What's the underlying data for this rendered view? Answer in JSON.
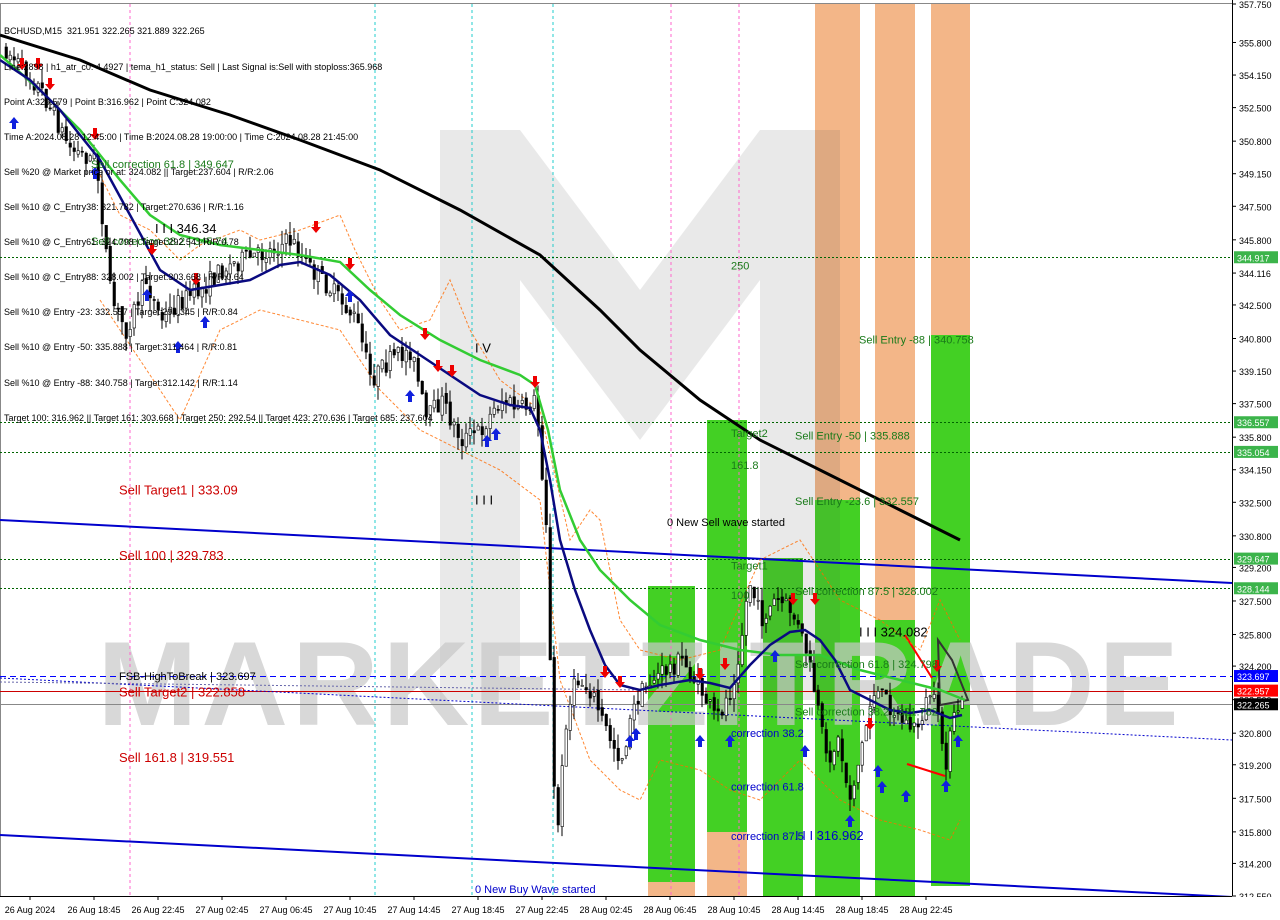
{
  "header": {
    "symbol": "BCHUSD,M15",
    "ohlc": "321.951 322.265 321.889 322.265"
  },
  "info_lines": [
    "Line:2898 | h1_atr_c0: 4.4927 | tema_h1_status: Sell | Last Signal is:Sell with stoploss:365.968",
    "Point A:329.579 | Point B:316.962 | Point C:324.082",
    "Time A:2024.08.28 12:45:00 | Time B:2024.08.28 19:00:00 | Time C:2024.08.28 21:45:00",
    "Sell %20 @ Market price or at: 324.082 || Target:237.604 | R/R:2.06",
    "Sell %10 @ C_Entry38: 321.782 | Target:270.636 | R/R:1.16",
    "Sell %10 @ C_Entry61: 324.798 | Target:292.54 | R/R:0.78",
    "Sell %10 @ C_Entry88: 328.002 | Target:303.668 | R/R:0.64",
    "Sell %10 @ Entry -23: 332.557 | Target:294.345 | R/R:0.84",
    "Sell %10 @ Entry -50: 335.888 | Target:311.464 | R/R:0.81",
    "Sell %10 @ Entry -88: 340.758 | Target:312.142 | R/R:1.14",
    "Target 100: 316.962 || Target 161: 303.668 | Target 250: 292.54 || Target 423: 270.636 | Target 685: 237.604"
  ],
  "watermark": "MARKETZITRADE",
  "colors": {
    "green_zone": "#33cc11",
    "orange_zone": "#f0a266",
    "ema_green": "#33cc33",
    "ema_navy": "#0a0a80",
    "ma_black": "#000000",
    "channel_blue": "#0000cc",
    "level_green": "#006400",
    "level_red": "#cc0000",
    "level_blue": "#0000ff"
  },
  "chart_data": {
    "type": "candlestick",
    "ylim": [
      312.55,
      357.75
    ],
    "y_ticks": [
      "357.750",
      "355.800",
      "354.150",
      "352.500",
      "350.800",
      "349.150",
      "347.500",
      "345.800",
      "344.116",
      "342.500",
      "340.800",
      "339.150",
      "337.500",
      "335.800",
      "334.150",
      "332.500",
      "330.800",
      "329.200",
      "327.500",
      "325.800",
      "324.200",
      "322.500",
      "320.800",
      "319.200",
      "317.500",
      "315.800",
      "314.200",
      "312.550"
    ],
    "x_ticks": [
      "26 Aug 2024",
      "26 Aug 18:45",
      "26 Aug 22:45",
      "27 Aug 02:45",
      "27 Aug 06:45",
      "27 Aug 10:45",
      "27 Aug 14:45",
      "27 Aug 18:45",
      "27 Aug 22:45",
      "28 Aug 02:45",
      "28 Aug 06:45",
      "28 Aug 10:45",
      "28 Aug 14:45",
      "28 Aug 18:45",
      "28 Aug 22:45"
    ],
    "price_tags": [
      {
        "value": 344.917,
        "label": "344.917",
        "color": "#3cb44b"
      },
      {
        "value": 336.557,
        "label": "336.557",
        "color": "#3cb44b"
      },
      {
        "value": 335.054,
        "label": "335.054",
        "color": "#3cb44b"
      },
      {
        "value": 329.647,
        "label": "329.647",
        "color": "#3cb44b"
      },
      {
        "value": 328.144,
        "label": "328.144",
        "color": "#3cb44b"
      },
      {
        "value": 323.697,
        "label": "323.697",
        "color": "#0000ff"
      },
      {
        "value": 322.957,
        "label": "322.957",
        "color": "#ff0000"
      },
      {
        "value": 322.265,
        "label": "322.265",
        "color": "#000000"
      }
    ],
    "horizontal_levels": [
      {
        "value": 344.917,
        "style": "dotted",
        "color": "#006400"
      },
      {
        "value": 336.557,
        "style": "dotted",
        "color": "#006400"
      },
      {
        "value": 335.054,
        "style": "dotted",
        "color": "#006400"
      },
      {
        "value": 329.647,
        "style": "dotted",
        "color": "#006400"
      },
      {
        "value": 328.144,
        "style": "dotted",
        "color": "#006400"
      },
      {
        "value": 323.697,
        "style": "dashed",
        "color": "#0000ff"
      },
      {
        "value": 322.957,
        "style": "solid",
        "color": "#cc0000"
      },
      {
        "value": 322.265,
        "style": "solid",
        "color": "#888888"
      }
    ],
    "annotations": [
      {
        "text": "Sell correction 61.8 | 349.647",
        "x": "26 Aug 18:45",
        "y": 349.647,
        "color": "#1a7a1a"
      },
      {
        "text": "I I I 346.34",
        "x": "26 Aug 22:45",
        "y": 346.34,
        "color": "#000000",
        "size": "large"
      },
      {
        "text": "Sell correction 38.2 | 345.74",
        "x": "26 Aug 18:45",
        "y": 345.74,
        "color": "#1a7a1a"
      },
      {
        "text": "I V",
        "x": "27 Aug 18:45",
        "y": 340.3,
        "color": "#000000",
        "size": "large"
      },
      {
        "text": "Sell Target1 | 333.09",
        "x": "26 Aug 2024",
        "y": 333.09,
        "color": "#cc0000",
        "size": "large"
      },
      {
        "text": "I I I",
        "x": "27 Aug 18:45",
        "y": 332.6,
        "color": "#000000",
        "size": "large"
      },
      {
        "text": "Sell 100 | 329.783",
        "x": "26 Aug 2024",
        "y": 329.783,
        "color": "#cc0000",
        "size": "large"
      },
      {
        "text": "FSB-HighToBreak | 323.697",
        "x": "26 Aug 2024",
        "y": 323.697,
        "color": "#000000"
      },
      {
        "text": "Sell Target2 | 322.858",
        "x": "26 Aug 2024",
        "y": 322.858,
        "color": "#cc0000",
        "size": "large"
      },
      {
        "text": "Sell 161.8 | 319.551",
        "x": "26 Aug 2024",
        "y": 319.551,
        "color": "#cc0000",
        "size": "large"
      },
      {
        "text": "0 New Buy Wave started",
        "x": "27 Aug 18:45",
        "y": 312.9,
        "color": "#0000cc"
      },
      {
        "text": "0 New Sell wave started",
        "x": "28 Aug 06:45",
        "y": 331.5,
        "color": "#000000"
      },
      {
        "text": "250",
        "x": "28 Aug 10:45",
        "y": 344.5,
        "color": "#1a7a1a"
      },
      {
        "text": "Target2",
        "x": "28 Aug 10:45",
        "y": 336.0,
        "color": "#1a7a1a"
      },
      {
        "text": "161.8",
        "x": "28 Aug 10:45",
        "y": 334.4,
        "color": "#1a7a1a"
      },
      {
        "text": "Target1",
        "x": "28 Aug 10:45",
        "y": 329.3,
        "color": "#1a7a1a"
      },
      {
        "text": "100",
        "x": "28 Aug 10:45",
        "y": 327.8,
        "color": "#1a7a1a"
      },
      {
        "text": "Sell Entry -88 | 340.758",
        "x": "28 Aug 18:45",
        "y": 340.758,
        "color": "#1a7a1a"
      },
      {
        "text": "Sell Entry -50 | 335.888",
        "x": "28 Aug 14:45",
        "y": 335.888,
        "color": "#1a7a1a"
      },
      {
        "text": "Sell Entry -23.6 | 332.557",
        "x": "28 Aug 14:45",
        "y": 332.557,
        "color": "#1a7a1a"
      },
      {
        "text": "Sell correction 87.5 | 328.002",
        "x": "28 Aug 14:45",
        "y": 328.002,
        "color": "#1a7a1a"
      },
      {
        "text": "I I I 324.082",
        "x": "28 Aug 18:45",
        "y": 325.9,
        "color": "#000000",
        "size": "large"
      },
      {
        "text": "Sell correction 61.8 | 324.798",
        "x": "28 Aug 14:45",
        "y": 324.3,
        "color": "#1a7a1a"
      },
      {
        "text": "Sell correction 38.2 | 321.782",
        "x": "28 Aug 14:45",
        "y": 321.9,
        "color": "#1a7a1a"
      },
      {
        "text": "correction 38.2",
        "x": "28 Aug 10:45",
        "y": 320.8,
        "color": "#0000cc"
      },
      {
        "text": "correction 61.8",
        "x": "28 Aug 10:45",
        "y": 318.1,
        "color": "#0000cc"
      },
      {
        "text": "correction 87.5",
        "x": "28 Aug 10:45",
        "y": 315.6,
        "color": "#0000cc"
      },
      {
        "text": "I I I 316.962",
        "x": "28 Aug 14:45",
        "y": 315.6,
        "color": "#0000cc",
        "size": "large"
      }
    ]
  }
}
